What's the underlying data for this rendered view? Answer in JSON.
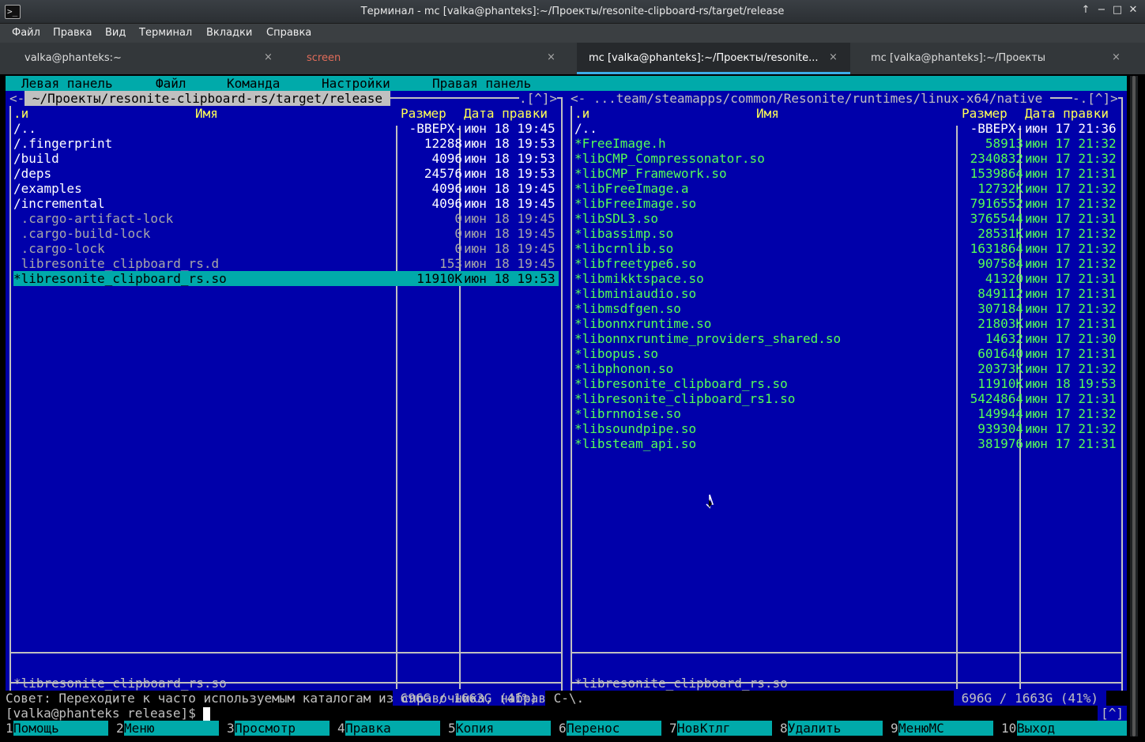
{
  "window": {
    "title": "Терминал - mc [valka@phanteks]:~/Проекты/resonite-clipboard-rs/target/release",
    "app_icon": ">_",
    "buttons": [
      "↑",
      "−",
      "□",
      "✕"
    ]
  },
  "menubar": [
    "Файл",
    "Правка",
    "Вид",
    "Терминал",
    "Вкладки",
    "Справка"
  ],
  "tabs": [
    {
      "label": "valka@phanteks:~",
      "close": "×",
      "color": "#dddddd"
    },
    {
      "label": "screen",
      "close": "×",
      "color": "#e06c5a"
    },
    {
      "label": "mc [valka@phanteks]:~/Проекты/resonite...",
      "close": "×",
      "color": "#ffffff"
    },
    {
      "label": "mc [valka@phanteks]:~/Проекты",
      "close": "×",
      "color": "#dddddd"
    }
  ],
  "mc_menu": [
    "Левая панель",
    "Файл",
    "Команда",
    "Настройки",
    "Правая панель"
  ],
  "left_panel": {
    "path_prefix": "<-",
    "path": " ~/Проекты/resonite-clipboard-rs/target/release ",
    "corner": ".[^]>",
    "headers": {
      "sort": ".и",
      "name": "Имя",
      "size": "Размер",
      "date": "Дата правки"
    },
    "files": [
      {
        "name": "/..",
        "size": "-ВВЕРХ-",
        "date": "июн 18 19:45",
        "kind": "dir"
      },
      {
        "name": "/.fingerprint",
        "size": "12288",
        "date": "июн 18 19:53",
        "kind": "dir"
      },
      {
        "name": "/build",
        "size": "4096",
        "date": "июн 18 19:53",
        "kind": "dir"
      },
      {
        "name": "/deps",
        "size": "24576",
        "date": "июн 18 19:53",
        "kind": "dir"
      },
      {
        "name": "/examples",
        "size": "4096",
        "date": "июн 18 19:45",
        "kind": "dir"
      },
      {
        "name": "/incremental",
        "size": "4096",
        "date": "июн 18 19:45",
        "kind": "dir"
      },
      {
        "name": " .cargo-artifact-lock",
        "size": "0",
        "date": "июн 18 19:45",
        "kind": "dim"
      },
      {
        "name": " .cargo-build-lock",
        "size": "0",
        "date": "июн 18 19:45",
        "kind": "dim"
      },
      {
        "name": " .cargo-lock",
        "size": "0",
        "date": "июн 18 19:45",
        "kind": "dim"
      },
      {
        "name": " libresonite_clipboard_rs.d",
        "size": "153",
        "date": "июн 18 19:45",
        "kind": "dim"
      },
      {
        "name": "*libresonite_clipboard_rs.so",
        "size": "11910K",
        "date": "июн 18 19:53",
        "kind": "sel"
      }
    ],
    "mini_status": "*libresonite_clipboard_rs.so",
    "free": " 696G / 1663G (41%) "
  },
  "right_panel": {
    "path_prefix": "<-",
    "path": " ...team/steamapps/common/Resonite/runtimes/linux-x64/native ",
    "corner": "-.[^]>",
    "headers": {
      "sort": ".и",
      "name": "Имя",
      "size": "Размер",
      "date": "Дата правки"
    },
    "files": [
      {
        "name": "/..",
        "size": "-ВВЕРХ-",
        "date": "июн 17 21:36",
        "kind": "dir"
      },
      {
        "name": "*FreeImage.h",
        "size": "58913",
        "date": "июн 17 21:32",
        "kind": "exe"
      },
      {
        "name": "*libCMP_Compressonator.so",
        "size": "2340832",
        "date": "июн 17 21:32",
        "kind": "exe"
      },
      {
        "name": "*libCMP_Framework.so",
        "size": "1539864",
        "date": "июн 17 21:31",
        "kind": "exe"
      },
      {
        "name": "*libFreeImage.a",
        "size": "12732K",
        "date": "июн 17 21:32",
        "kind": "exe"
      },
      {
        "name": "*libFreeImage.so",
        "size": "7916552",
        "date": "июн 17 21:32",
        "kind": "exe"
      },
      {
        "name": "*libSDL3.so",
        "size": "3765544",
        "date": "июн 17 21:31",
        "kind": "exe"
      },
      {
        "name": "*libassimp.so",
        "size": "28531K",
        "date": "июн 17 21:32",
        "kind": "exe"
      },
      {
        "name": "*libcrnlib.so",
        "size": "1631864",
        "date": "июн 17 21:32",
        "kind": "exe"
      },
      {
        "name": "*libfreetype6.so",
        "size": "907584",
        "date": "июн 17 21:32",
        "kind": "exe"
      },
      {
        "name": "*libmikktspace.so",
        "size": "41320",
        "date": "июн 17 21:31",
        "kind": "exe"
      },
      {
        "name": "*libminiaudio.so",
        "size": "849112",
        "date": "июн 17 21:31",
        "kind": "exe"
      },
      {
        "name": "*libmsdfgen.so",
        "size": "307184",
        "date": "июн 17 21:32",
        "kind": "exe"
      },
      {
        "name": "*libonnxruntime.so",
        "size": "21803K",
        "date": "июн 17 21:31",
        "kind": "exe"
      },
      {
        "name": "*libonnxruntime_providers_shared.so",
        "size": "14632",
        "date": "июн 17 21:30",
        "kind": "exe"
      },
      {
        "name": "*libopus.so",
        "size": "601640",
        "date": "июн 17 21:31",
        "kind": "exe"
      },
      {
        "name": "*libphonon.so",
        "size": "20373K",
        "date": "июн 17 21:32",
        "kind": "exe"
      },
      {
        "name": "*libresonite_clipboard_rs.so",
        "size": "11910K",
        "date": "июн 18 19:53",
        "kind": "exe"
      },
      {
        "name": "*libresonite_clipboard_rs1.so",
        "size": "5424864",
        "date": "июн 17 21:31",
        "kind": "exe"
      },
      {
        "name": "*librnnoise.so",
        "size": "149944",
        "date": "июн 17 21:32",
        "kind": "exe"
      },
      {
        "name": "*libsoundpipe.so",
        "size": "939304",
        "date": "июн 17 21:32",
        "kind": "exe"
      },
      {
        "name": "*libsteam_api.so",
        "size": "381976",
        "date": "июн 17 21:31",
        "kind": "exe"
      }
    ],
    "mini_status": "*libresonite_clipboard_rs.so",
    "free": " 696G / 1663G (41%) "
  },
  "hint": "Совет: Переходите к часто используемым каталогам из справочника, набрав C-\\.",
  "prompt": "[valka@phanteks release]$ ",
  "prompt_history": "[^]",
  "fkeys": [
    {
      "n": "1",
      "label": "Помощь"
    },
    {
      "n": "2",
      "label": "Меню"
    },
    {
      "n": "3",
      "label": "Просмотр"
    },
    {
      "n": "4",
      "label": "Правка"
    },
    {
      "n": "5",
      "label": "Копия"
    },
    {
      "n": "6",
      "label": "Перенос"
    },
    {
      "n": "7",
      "label": "НовКтлг"
    },
    {
      "n": "8",
      "label": "Удалить"
    },
    {
      "n": "9",
      "label": "МенюMC"
    },
    {
      "n": "10",
      "label": "Выход"
    }
  ],
  "colors": {
    "panel_bg": "#0000aa",
    "cyan": "#00aaaa",
    "executable": "#55ff55",
    "header_yellow": "#ffff55"
  }
}
